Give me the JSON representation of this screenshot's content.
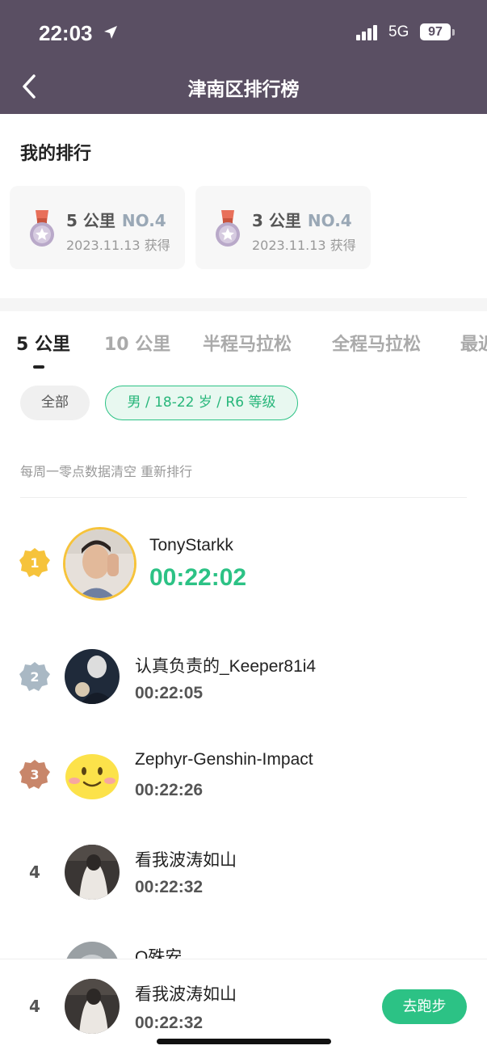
{
  "status_bar": {
    "time": "22:03",
    "network": "5G",
    "battery": "97"
  },
  "header": {
    "title": "津南区排行榜"
  },
  "my_rank": {
    "title": "我的排行",
    "cards": [
      {
        "distance": "5 公里",
        "rank": "NO.4",
        "date": "2023.11.13 获得"
      },
      {
        "distance": "3 公里",
        "rank": "NO.4",
        "date": "2023.11.13 获得"
      }
    ]
  },
  "tabs": [
    {
      "label": "5 公里",
      "active": true
    },
    {
      "label": "10 公里",
      "active": false
    },
    {
      "label": "半程马拉松",
      "active": false
    },
    {
      "label": "全程马拉松",
      "active": false
    },
    {
      "label": "最近",
      "active": false
    }
  ],
  "filters": {
    "all": "全部",
    "selected": "男 / 18-22 岁 / R6 等级"
  },
  "note": "每周一零点数据清空 重新排行",
  "ranking": [
    {
      "rank": "1",
      "name": "TonyStarkk",
      "time": "00:22:02"
    },
    {
      "rank": "2",
      "name": "认真负责的_Keeper81i4",
      "time": "00:22:05"
    },
    {
      "rank": "3",
      "name": "Zephyr-Genshin-Impact",
      "time": "00:22:26"
    },
    {
      "rank": "4",
      "name": "看我波涛如山",
      "time": "00:22:32"
    },
    {
      "rank": "",
      "name": "Q殊安",
      "time": ""
    }
  ],
  "me": {
    "rank": "4",
    "name": "看我波涛如山",
    "time": "00:22:32",
    "button": "去跑步"
  },
  "colors": {
    "header_bg": "#5a4f63",
    "accent": "#2cc285",
    "gold": "#f6c33b",
    "silver": "#a9b8c4",
    "bronze": "#c8866a"
  }
}
